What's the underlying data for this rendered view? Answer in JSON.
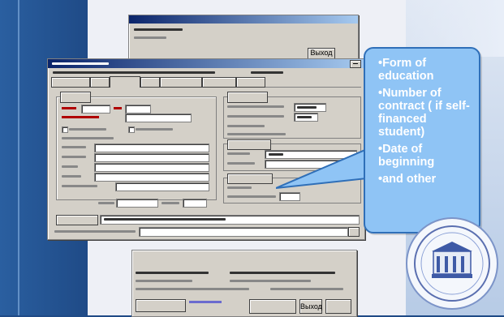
{
  "back_window": {
    "button_label": "Выход"
  },
  "bottom_window": {
    "button_label": "Выход"
  },
  "callout": {
    "items": [
      "•Form of education",
      "•Number of contract ( if self-financed student)",
      "•Date of beginning",
      "•and other"
    ]
  },
  "colors": {
    "callout_fill": "#8fc4f5",
    "callout_border": "#2f6fb8",
    "background": "#1f4a86"
  },
  "icons": {
    "close": "close-icon",
    "seal": "university-seal-icon"
  }
}
